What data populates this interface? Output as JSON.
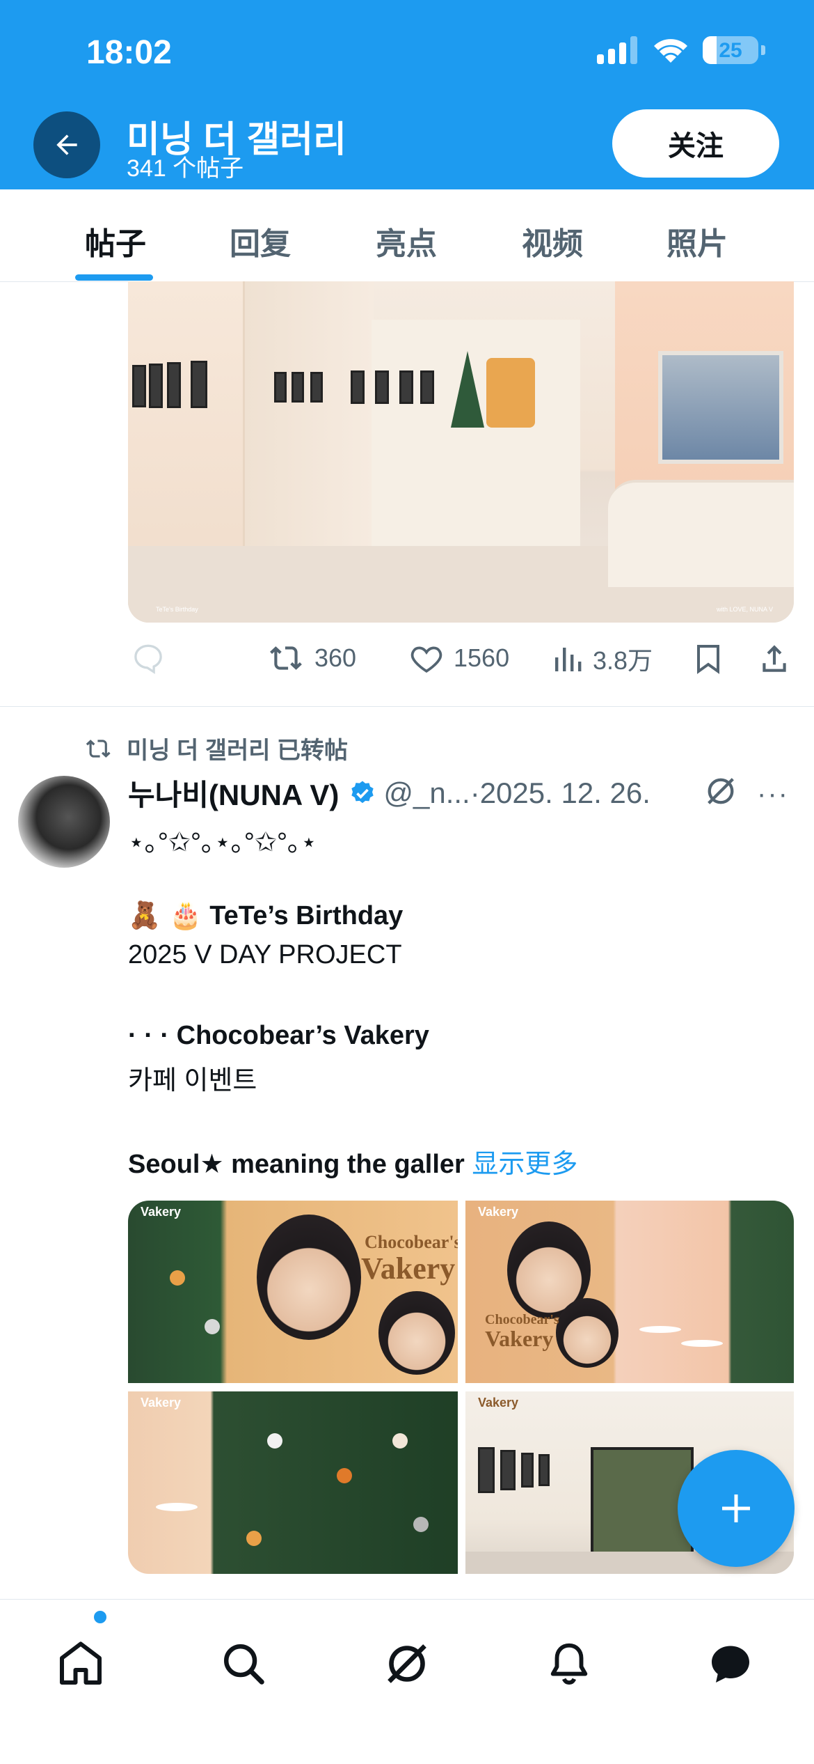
{
  "status_bar": {
    "time": "18:02",
    "battery": "25",
    "battery_level": 0.25
  },
  "header": {
    "title": "미닝 더 갤러리",
    "subtitle": "341 个帖子",
    "follow_label": "关注"
  },
  "tabs": [
    {
      "label": "帖子",
      "active": true
    },
    {
      "label": "回复",
      "active": false
    },
    {
      "label": "亮点",
      "active": false
    },
    {
      "label": "视频",
      "active": false
    },
    {
      "label": "照片",
      "active": false
    }
  ],
  "top_post": {
    "image_captions": {
      "left": "TeTe's Birthday",
      "right": "with LOVE, NUNA V"
    },
    "stats": {
      "reposts": "360",
      "likes": "1560",
      "views": "3.8万"
    }
  },
  "second_post": {
    "repost_line": "미닝 더 갤러리 已转帖",
    "author_name": "누나비(NUNA V)",
    "handle": "@_n...",
    "date": "2025. 12. 26.",
    "line1": "⋆｡°✩°｡⋆｡°✩°｡⋆",
    "emoji": "🧸 🎂",
    "birthday": "TeTe’s Birthday",
    "project": "2025 V DAY PROJECT",
    "dots": "· · ·",
    "vakery": "Chocobear’s Vakery",
    "cafe": "카페 이벤트",
    "seoul": "Seoul★ meaning the galler",
    "show_more": "显示更多",
    "images": {
      "card_title_a": "Chocobear's",
      "card_title_b": "Vakery",
      "tag": "Vakery"
    }
  },
  "colors": {
    "accent": "#1d9bf0",
    "text": "#0f1419",
    "muted": "#536471"
  },
  "icons": [
    "back-arrow-icon",
    "reply-icon",
    "repost-icon",
    "like-icon",
    "views-icon",
    "bookmark-icon",
    "share-icon",
    "verified-icon",
    "grok-icon",
    "more-icon",
    "plus-icon",
    "home-icon",
    "search-icon",
    "grok-nav-icon",
    "bell-icon",
    "messages-icon"
  ]
}
